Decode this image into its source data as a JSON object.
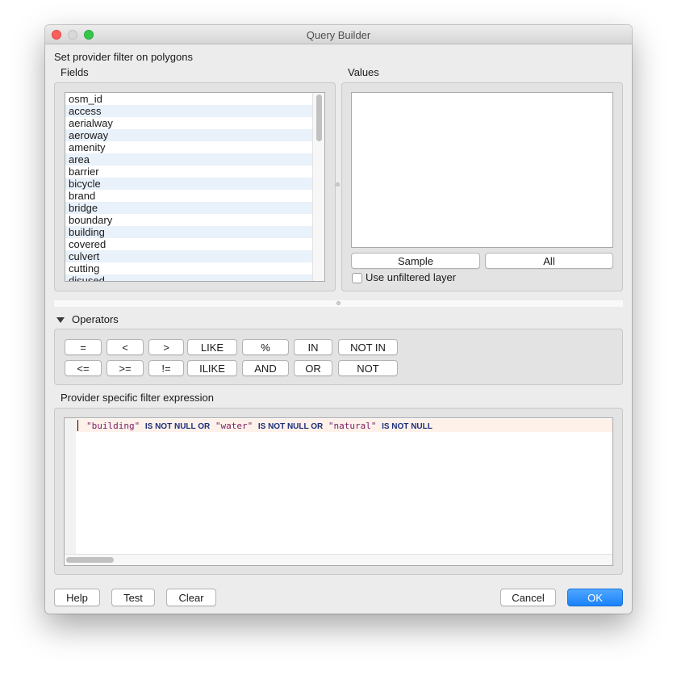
{
  "window": {
    "title": "Query Builder"
  },
  "header": {
    "set_filter_label": "Set provider filter on polygons"
  },
  "fields": {
    "label": "Fields",
    "items": [
      "osm_id",
      "access",
      "aerialway",
      "aeroway",
      "amenity",
      "area",
      "barrier",
      "bicycle",
      "brand",
      "bridge",
      "boundary",
      "building",
      "covered",
      "culvert",
      "cutting",
      "disused"
    ]
  },
  "values": {
    "label": "Values",
    "sample_label": "Sample",
    "all_label": "All",
    "use_unfiltered_label": "Use unfiltered layer",
    "use_unfiltered_checked": false
  },
  "operators": {
    "label": "Operators",
    "row1": [
      "=",
      "<",
      ">",
      "LIKE",
      "%",
      "IN",
      "NOT IN"
    ],
    "row2": [
      "<=",
      ">=",
      "!=",
      "ILIKE",
      "AND",
      "OR",
      "NOT"
    ]
  },
  "expression": {
    "label": "Provider specific filter expression",
    "tokens": [
      {
        "text": "\"building\"",
        "kind": "str"
      },
      {
        "text": "IS NOT NULL OR",
        "kind": "kw"
      },
      {
        "text": "\"water\"",
        "kind": "str"
      },
      {
        "text": "IS NOT NULL OR",
        "kind": "kw"
      },
      {
        "text": "\"natural\"",
        "kind": "str"
      },
      {
        "text": "IS NOT NULL",
        "kind": "kw"
      }
    ]
  },
  "footer": {
    "help_label": "Help",
    "test_label": "Test",
    "clear_label": "Clear",
    "cancel_label": "Cancel",
    "ok_label": "OK"
  },
  "colors": {
    "accent": "#1a82fb",
    "keyword": "#1c2f7a",
    "string": "#7a1b64",
    "list_alt_row": "#e9f1fb"
  }
}
